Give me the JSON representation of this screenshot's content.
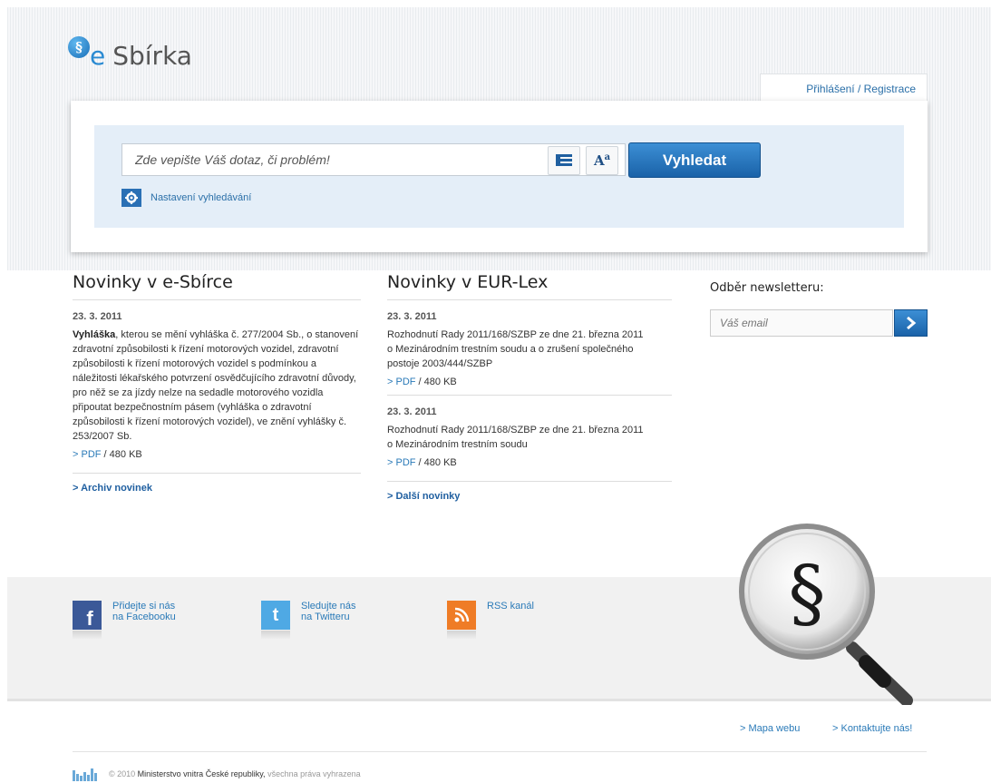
{
  "header": {
    "logo_e": "e",
    "logo_text": "Sbírka",
    "login_link": "Přihlášení / Registrace"
  },
  "search": {
    "placeholder": "Zde vepište Váš dotaz, či problém!",
    "button_label": "Vyhledat",
    "settings_label": "Nastavení vyhledávání"
  },
  "news_esbirka": {
    "title": "Novinky v e-Sbírce",
    "items": [
      {
        "date": "23. 3. 2011",
        "lead": "Vyhláška",
        "text": ", kterou se mění vyhláška č. 277/2004 Sb., o stanovení zdravotní způsobilosti k řízení motorových vozidel, zdravotní způsobilosti k řízení motorových vozidel s podmínkou a náležitosti lékařského potvrzení osvědčujícího zdravotní důvody, pro něž se za jízdy nelze na sedadle motorového vozidla připoutat bezpečnostním pásem (vyhláška o zdravotní způsobilosti k řízení motorových vozidel), ve znění vyhlášky č. 253/2007 Sb.",
        "pdf_label": "> PDF",
        "size": "/ 480 KB"
      }
    ],
    "more": "> Archiv novinek"
  },
  "news_eurlex": {
    "title": "Novinky v EUR-Lex",
    "items": [
      {
        "date": "23. 3. 2011",
        "text": "Rozhodnutí Rady 2011/168/SZBP ze dne 21. března 2011 o Mezinárodním trestním soudu a o zrušení společného postoje 2003/444/SZBP",
        "pdf_label": "> PDF",
        "size": "/ 480 KB"
      },
      {
        "date": "23. 3. 2011",
        "text": "Rozhodnutí Rady 2011/168/SZBP ze dne 21. března 2011 o Mezinárodním trestním soudu",
        "pdf_label": "> PDF",
        "size": "/ 480 KB"
      }
    ],
    "more": "> Další novinky"
  },
  "newsletter": {
    "title": "Odběr newsletteru:",
    "placeholder": "Váš email"
  },
  "social": {
    "facebook": {
      "line1": "Přidejte si nás",
      "line2": "na Facebooku"
    },
    "twitter": {
      "line1": "Sledujte nás",
      "line2": "na Twitteru"
    },
    "rss": {
      "line1": "RSS kanál"
    }
  },
  "magnifier_symbol": "§",
  "bottom_links": {
    "sitemap": "> Mapa webu",
    "contact": "> Kontaktujte nás!"
  },
  "footer": {
    "copyright": "© 2010",
    "ministry": "Ministerstvo vnitra České republiky,",
    "rights": "všechna práva vyhrazena"
  },
  "colors": {
    "accent": "#1a62a8",
    "link": "#2a7ab8",
    "search_bg": "#e4eef8"
  }
}
